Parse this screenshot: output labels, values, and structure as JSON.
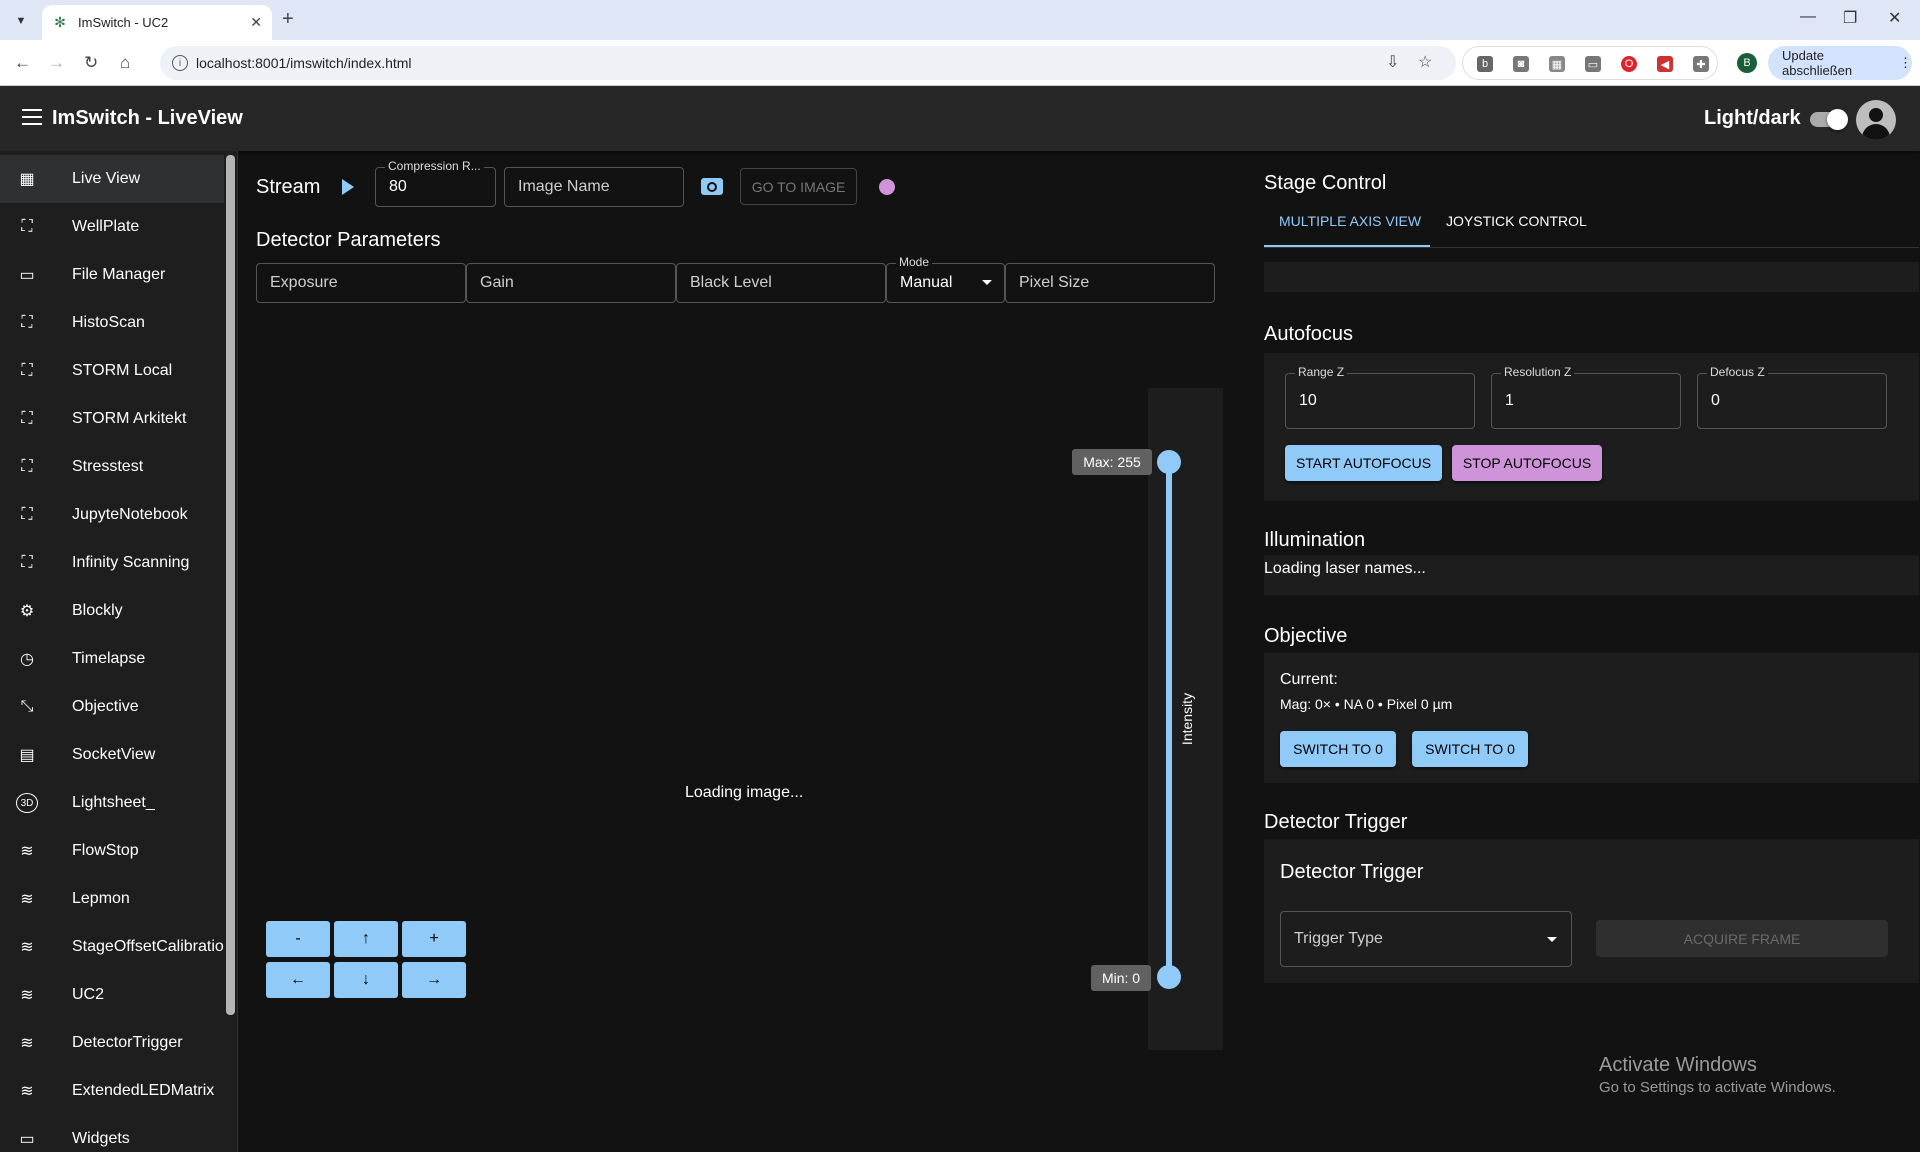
{
  "browser": {
    "tab_title": "ImSwitch - UC2",
    "url": "localhost:8001/imswitch/index.html",
    "profile_initial": "B",
    "update_label": "Update abschließen"
  },
  "appbar": {
    "title": "ImSwitch - LiveView",
    "theme_label": "Light/dark"
  },
  "sidebar": {
    "items": [
      {
        "label": "Live View",
        "icon": "dashboard-icon"
      },
      {
        "label": "WellPlate",
        "icon": "frame-icon"
      },
      {
        "label": "File Manager",
        "icon": "devices-icon"
      },
      {
        "label": "HistoScan",
        "icon": "frame-icon"
      },
      {
        "label": "STORM Local",
        "icon": "frame-icon"
      },
      {
        "label": "STORM Arkitekt",
        "icon": "frame-icon"
      },
      {
        "label": "Stresstest",
        "icon": "frame-icon"
      },
      {
        "label": "JupyteNotebook",
        "icon": "frame-icon"
      },
      {
        "label": "Infinity Scanning",
        "icon": "frame-icon"
      },
      {
        "label": "Blockly",
        "icon": "gear-icon"
      },
      {
        "label": "Timelapse",
        "icon": "clock-icon"
      },
      {
        "label": "Objective",
        "icon": "zoom-out-map-icon"
      },
      {
        "label": "SocketView",
        "icon": "chat-icon"
      },
      {
        "label": "Lightsheet_",
        "icon": "3d-icon"
      },
      {
        "label": "FlowStop",
        "icon": "air-icon"
      },
      {
        "label": "Lepmon",
        "icon": "air-icon"
      },
      {
        "label": "StageOffsetCalibratio",
        "icon": "air-icon"
      },
      {
        "label": "UC2",
        "icon": "air-icon"
      },
      {
        "label": "DetectorTrigger",
        "icon": "air-icon"
      },
      {
        "label": "ExtendedLEDMatrix",
        "icon": "air-icon"
      },
      {
        "label": "Widgets",
        "icon": "devices-icon"
      }
    ]
  },
  "stream": {
    "label": "Stream",
    "compression_label": "Compression R...",
    "compression_value": "80",
    "image_name_placeholder": "Image Name",
    "go_to_image": "GO TO IMAGE"
  },
  "detector": {
    "title": "Detector Parameters",
    "exposure": "Exposure",
    "gain": "Gain",
    "black_level": "Black Level",
    "mode_label": "Mode",
    "mode_value": "Manual",
    "pixel_size": "Pixel Size"
  },
  "viewer": {
    "loading": "Loading image...",
    "max_label": "Max: 255",
    "min_label": "Min: 0",
    "intensity_label": "Intensity",
    "intensity_max": 255,
    "intensity_min": 0
  },
  "jog": {
    "minus": "-",
    "up": "↑",
    "plus": "+",
    "left": "←",
    "down": "↓",
    "right": "→"
  },
  "stage": {
    "title": "Stage Control",
    "tab_multi": "MULTIPLE AXIS VIEW",
    "tab_joystick": "JOYSTICK CONTROL"
  },
  "autofocus": {
    "title": "Autofocus",
    "range_label": "Range Z",
    "range_value": "10",
    "resolution_label": "Resolution Z",
    "resolution_value": "1",
    "defocus_label": "Defocus Z",
    "defocus_value": "0",
    "start": "START AUTOFOCUS",
    "stop": "STOP AUTOFOCUS"
  },
  "illumination": {
    "title": "Illumination",
    "status": "Loading laser names..."
  },
  "objective": {
    "title": "Objective",
    "current_label": "Current:",
    "info": "Mag: 0× • NA 0 • Pixel 0 µm",
    "switch1": "SWITCH TO 0",
    "switch2": "SWITCH TO 0"
  },
  "trigger": {
    "title": "Detector Trigger",
    "subtitle": "Detector Trigger",
    "type_placeholder": "Trigger Type",
    "acquire": "ACQUIRE FRAME"
  },
  "watermark": {
    "line1": "Activate Windows",
    "line2": "Go to Settings to activate Windows."
  },
  "colors": {
    "accent": "#90caf9",
    "secondary": "#ce93d8",
    "background": "#121212",
    "appbar": "#272727"
  }
}
